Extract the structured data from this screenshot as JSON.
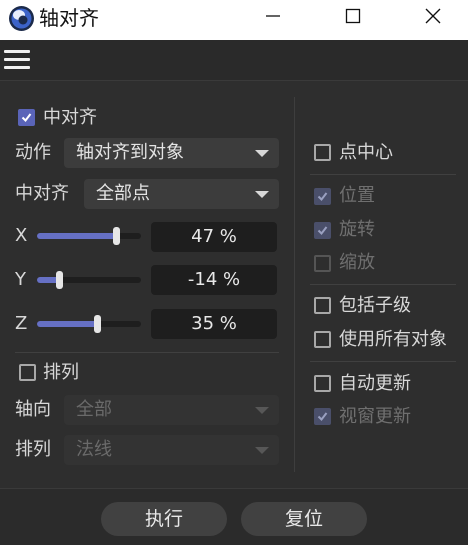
{
  "window": {
    "title": "轴对齐"
  },
  "left": {
    "center_align": {
      "label": "中对齐",
      "checked": true
    },
    "action": {
      "label": "动作",
      "value": "轴对齐到对象"
    },
    "center_mode": {
      "label": "中对齐",
      "value": "全部点"
    },
    "axes": [
      {
        "label": "X",
        "value": "47 %",
        "level": 0.47
      },
      {
        "label": "Y",
        "value": "-14 %",
        "level": -0.14
      },
      {
        "label": "Z",
        "value": "35 %",
        "level": 0.35
      }
    ],
    "arrange": {
      "label": "排列",
      "checked": false
    },
    "axis_dir": {
      "label": "轴向",
      "value": "全部"
    },
    "arrange_mode": {
      "label": "排列",
      "value": "法线"
    }
  },
  "right": {
    "point_center": {
      "label": "点中心",
      "checked": false
    },
    "position": {
      "label": "位置",
      "checked": true
    },
    "rotation": {
      "label": "旋转",
      "checked": true
    },
    "scale": {
      "label": "缩放",
      "checked": false
    },
    "include_children": {
      "label": "包括子级",
      "checked": false
    },
    "use_all_objects": {
      "label": "使用所有对象",
      "checked": false
    },
    "auto_update": {
      "label": "自动更新",
      "checked": false
    },
    "viewport_update": {
      "label": "视窗更新",
      "checked": true
    }
  },
  "footer": {
    "execute": "执行",
    "reset": "复位"
  },
  "colors": {
    "accent": "#6670c4",
    "background": "#2e2e2e",
    "field": "#1e1e1e"
  }
}
